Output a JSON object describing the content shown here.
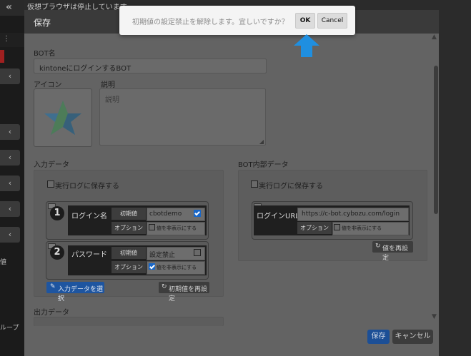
{
  "background": {
    "notice": "仮想ブラウザは停止しています。",
    "left_rail_label": "ループ",
    "left_tiny": "値"
  },
  "modal": {
    "title": "保存",
    "bot_name_label": "BOT名",
    "bot_name_value": "kintoneにログインするBOT",
    "icon_label": "アイコン",
    "description_label": "説明",
    "description_placeholder": "説明",
    "input_data": {
      "section_label": "入力データ",
      "save_log_label": "実行ログに保存する",
      "items": [
        {
          "number": "1",
          "name": "ログイン名",
          "initial_label": "初期値",
          "value": "cbotdemo",
          "value_checked": true,
          "option_label": "オプション",
          "hide_label": "値を非表示にする",
          "hide_checked": false
        },
        {
          "number": "2",
          "name": "パスワード",
          "initial_label": "初期値",
          "value": "設定禁止",
          "value_checked": false,
          "option_label": "オプション",
          "hide_label": "値を非表示にする",
          "hide_checked": true
        }
      ],
      "select_button": "入力データを選択",
      "reset_button": "初期値を再設定"
    },
    "bot_internal": {
      "section_label": "BOT内部データ",
      "save_log_label": "実行ログに保存する",
      "item": {
        "name": "ログインURL",
        "value": "https://c-bot.cybozu.com/login",
        "option_label": "オプション",
        "hide_label": "値を非表示にする",
        "hide_checked": false
      },
      "reset_button": "値を再設定"
    },
    "output_label": "出力データ",
    "footer": {
      "save": "保存",
      "cancel": "キャンセル"
    }
  },
  "dialog": {
    "message": "初期値の設定禁止を解除します。宜しいですか？",
    "ok": "OK",
    "cancel": "Cancel"
  },
  "colors": {
    "accent_blue": "#1e55a0",
    "arrow_blue": "#1f8fe0"
  }
}
